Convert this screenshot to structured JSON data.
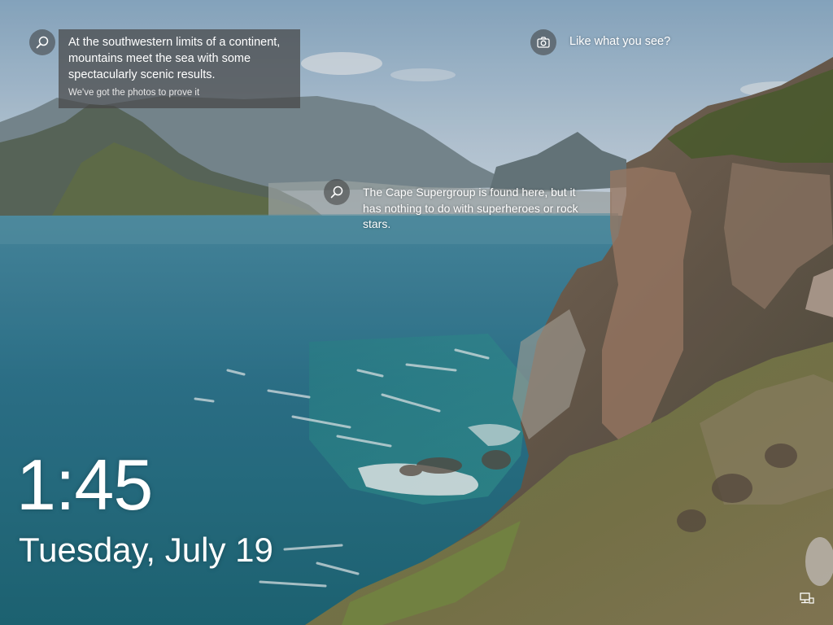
{
  "hotspots": {
    "fact": {
      "icon": "search-icon",
      "headline": "At the southwestern limits of a continent, mountains meet the sea with some spectacularly scenic results.",
      "subtext": "We've got the photos to prove it"
    },
    "like": {
      "icon": "camera-icon",
      "label": "Like what you see?"
    },
    "cape": {
      "icon": "search-icon",
      "text": "The Cape Supergroup is found here, but it has nothing to do with superheroes or rock stars."
    }
  },
  "clock": {
    "time": "1:45",
    "date": "Tuesday, July 19"
  },
  "system_tray": {
    "network_icon": "network-icon"
  },
  "colors": {
    "sky": "#9bb8cf",
    "sea": "#2c7d96",
    "card_background": "#464646",
    "text": "#ffffff"
  }
}
